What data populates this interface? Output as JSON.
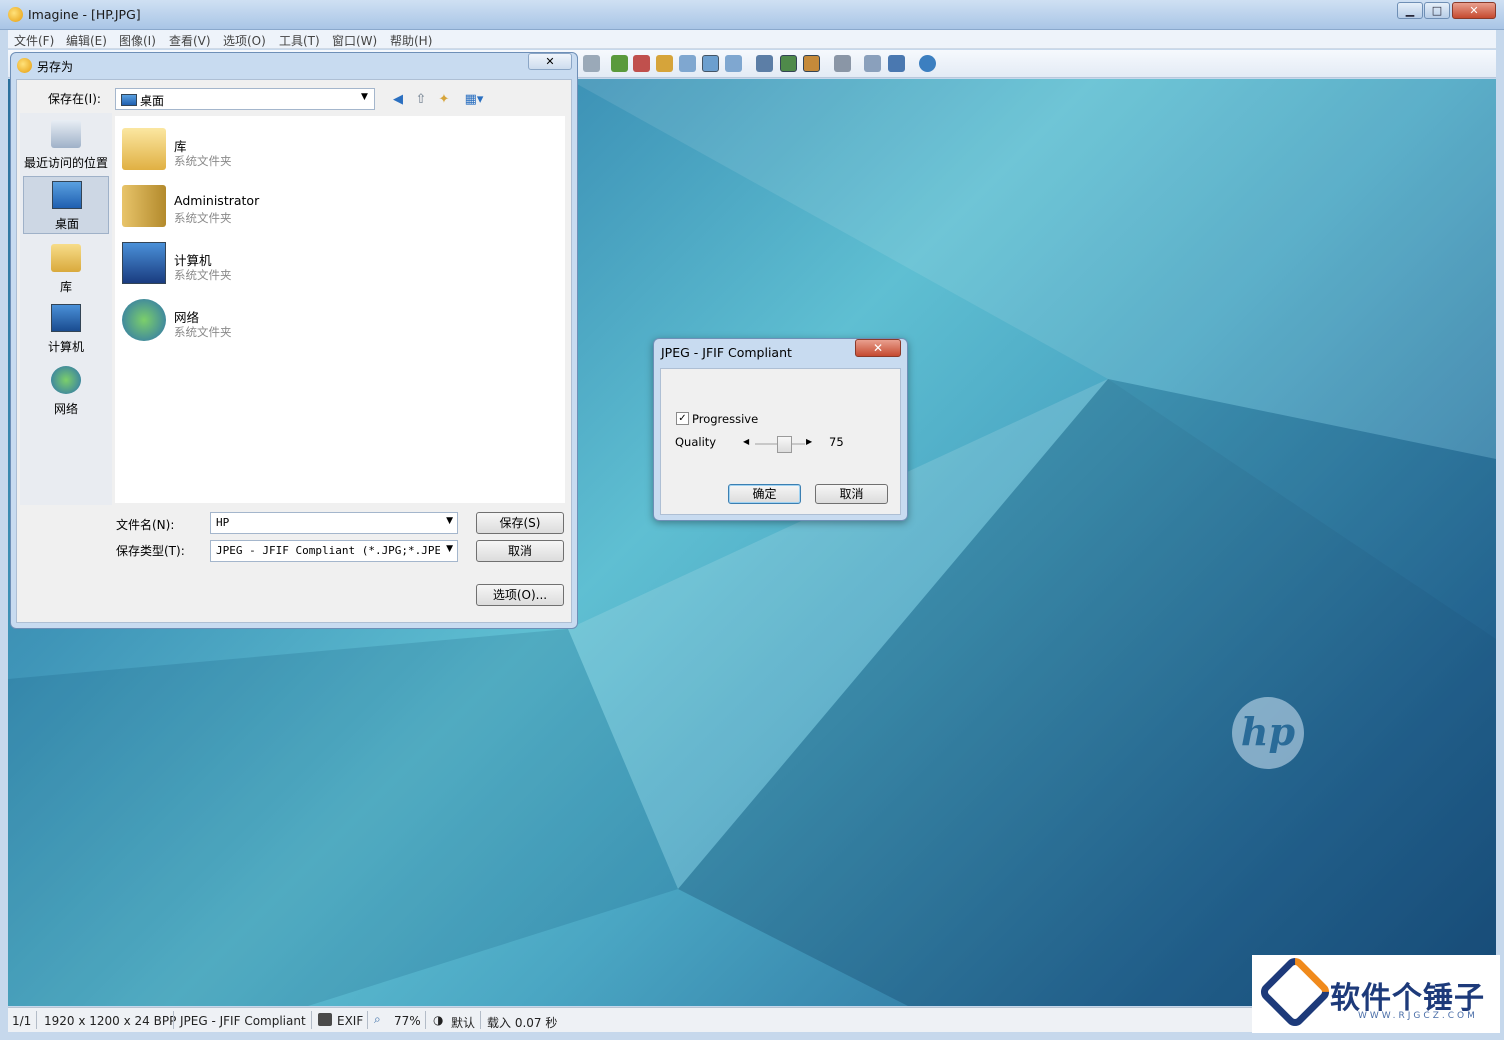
{
  "window": {
    "title": "Imagine - [HP.JPG]",
    "minimize": "▁",
    "maximize": "□",
    "close": "✕"
  },
  "menu": [
    {
      "label": "文件(F)"
    },
    {
      "label": "编辑(E)"
    },
    {
      "label": "图像(I)"
    },
    {
      "label": "查看(V)"
    },
    {
      "label": "选项(O)"
    },
    {
      "label": "工具(T)"
    },
    {
      "label": "窗口(W)"
    },
    {
      "label": "帮助(H)"
    }
  ],
  "save_dialog": {
    "title": "另存为",
    "close": "✕",
    "lookin_label": "保存在(I):",
    "lookin_value": "桌面",
    "places": [
      {
        "label": "最近访问的位置",
        "icon": "recent-places-icon"
      },
      {
        "label": "桌面",
        "icon": "desktop-icon"
      },
      {
        "label": "库",
        "icon": "library-icon"
      },
      {
        "label": "计算机",
        "icon": "computer-icon"
      },
      {
        "label": "网络",
        "icon": "network-icon"
      }
    ],
    "files": [
      {
        "name": "库",
        "desc": "系统文件夹",
        "icon": "library-folder-icon"
      },
      {
        "name": "Administrator",
        "desc": "系统文件夹",
        "icon": "user-folder-icon"
      },
      {
        "name": "计算机",
        "desc": "系统文件夹",
        "icon": "computer-icon"
      },
      {
        "name": "网络",
        "desc": "系统文件夹",
        "icon": "network-icon"
      }
    ],
    "filename_label": "文件名(N):",
    "filename_value": "HP",
    "filetype_label": "保存类型(T):",
    "filetype_value": "JPEG - JFIF Compliant (*.JPG;*.JPE;*.",
    "save_button": "保存(S)",
    "cancel_button": "取消",
    "options_button": "选项(O)..."
  },
  "jpeg_dialog": {
    "title": "JPEG - JFIF Compliant",
    "close": "✕",
    "progressive_label": "Progressive",
    "progressive_checked": true,
    "quality_label": "Quality",
    "quality_value": "75",
    "ok_button": "确定",
    "cancel_button": "取消"
  },
  "status": {
    "page": "1/1",
    "dims": "1920 x 1200 x 24 BPP",
    "format": "JPEG - JFIF Compliant",
    "exif": "EXIF",
    "zoom": "77%",
    "mode": "默认",
    "load": "载入 0.07 秒"
  },
  "wallpaper_logo": "hp",
  "watermark": {
    "text": "软件个锤子",
    "url": "WWW.RJGCZ.COM"
  }
}
